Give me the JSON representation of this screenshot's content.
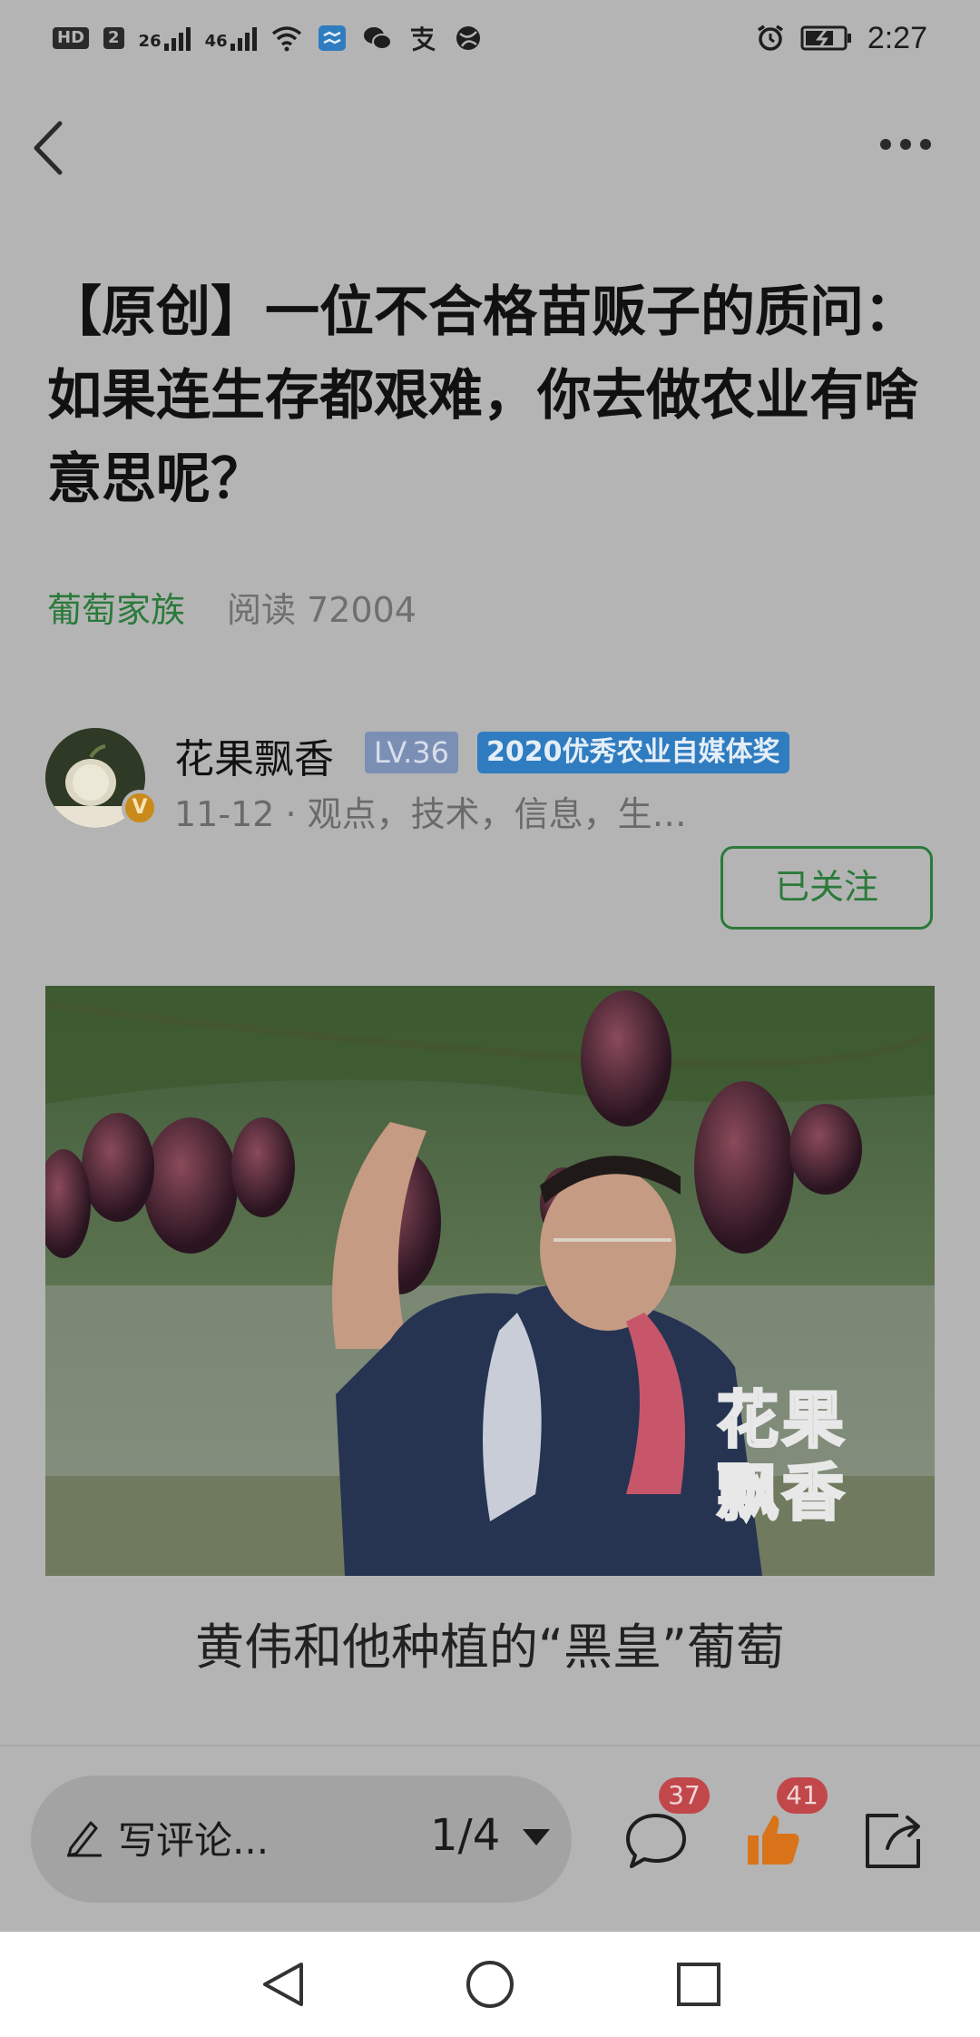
{
  "status_bar": {
    "hd_label": "HD",
    "sim_label": "2",
    "signal1_label": "26",
    "signal2_label": "46",
    "time": "2:27"
  },
  "article": {
    "title": "【原创】一位不合格苗贩子的质问：如果连生存都艰难，你去做农业有啥意思呢？",
    "category": "葡萄家族",
    "read_count": "阅读 72004"
  },
  "author": {
    "name": "花果飘香",
    "level": "LV.36",
    "award": "2020优秀农业自媒体奖",
    "verified_mark": "V",
    "subtitle": "11-12 · 观点，技术，信息，生…",
    "follow_label": "已关注"
  },
  "photo": {
    "watermark_line1": "花果",
    "watermark_line2": "飘香",
    "caption": "黄伟和他种植的“黑皇”葡萄"
  },
  "bottom_bar": {
    "comment_placeholder": "写评论...",
    "page_indicator": "1/4",
    "comment_count": "37",
    "like_count": "41"
  },
  "icons": {
    "back": "back-arrow-icon",
    "more": "more-dots-icon",
    "pencil": "pencil-icon",
    "comment": "comment-bubble-icon",
    "like": "thumbs-up-icon",
    "share": "share-icon"
  },
  "colors": {
    "accent_green": "#2b7a3b",
    "like_orange": "#d9731a",
    "badge_red": "#c2474a",
    "level_badge": "#7b8fb5",
    "award_badge": "#2f7cc0"
  }
}
